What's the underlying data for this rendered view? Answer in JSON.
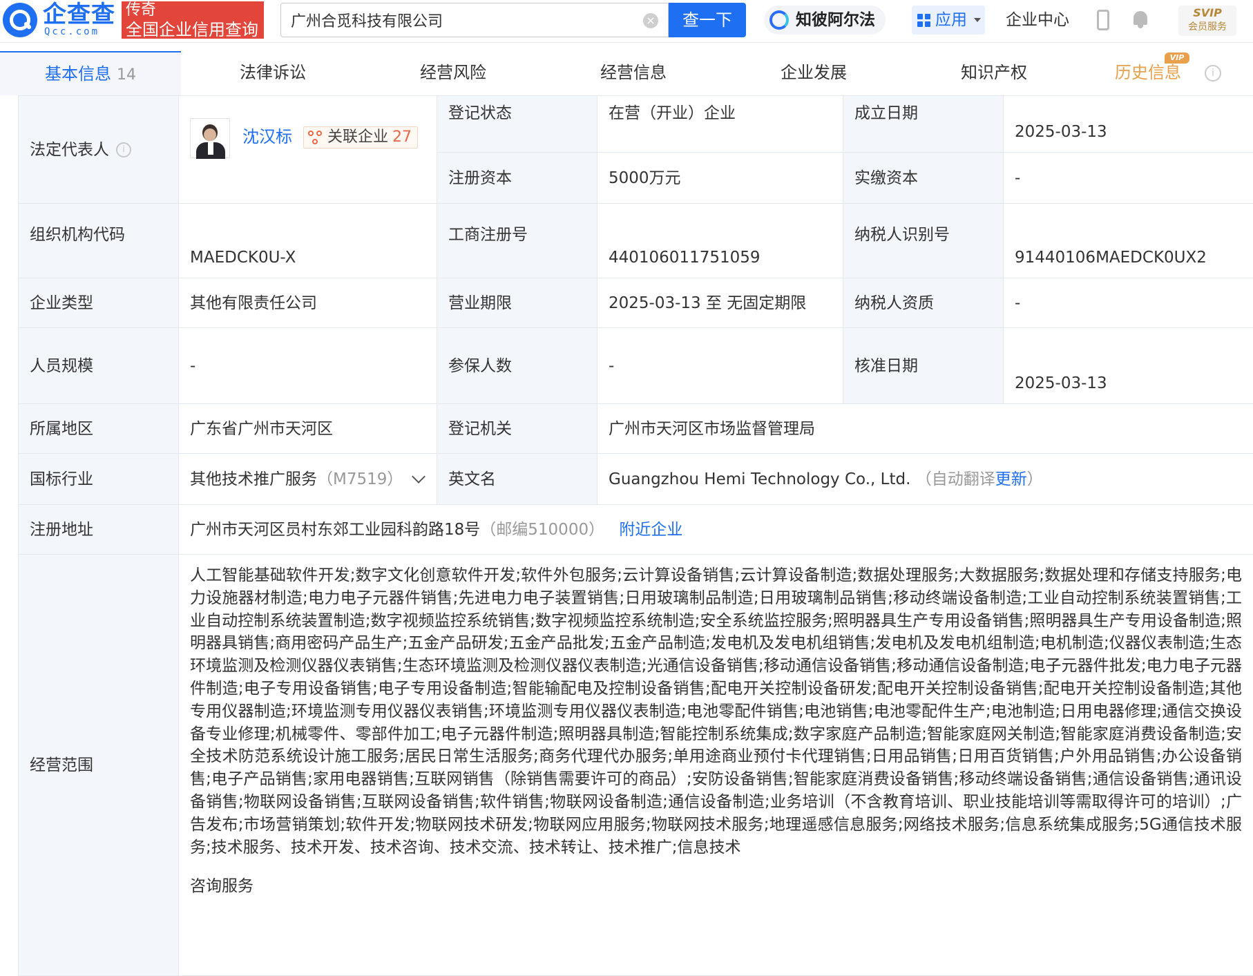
{
  "header": {
    "logo_text": "企查查",
    "logo_sub": "Qcc.com",
    "promo_line1": "传奇",
    "promo_line2": "全国企业信用查询",
    "search_value": "广州合觅科技有限公司",
    "search_button": "查一下",
    "zhibi_label": "知彼阿尔法",
    "apps_label": "应用",
    "enterprise_center": "企业中心",
    "svip_title": "SVIP",
    "svip_sub": "会员服务"
  },
  "tabs": [
    {
      "label": "基本信息",
      "count": "14"
    },
    {
      "label": "法律诉讼"
    },
    {
      "label": "经营风险"
    },
    {
      "label": "经营信息"
    },
    {
      "label": "企业发展"
    },
    {
      "label": "知识产权"
    },
    {
      "label": "历史信息",
      "badge": "VIP"
    }
  ],
  "info": {
    "legal_rep_label": "法定代表人",
    "legal_rep_name": "沈汉标",
    "related_label": "关联企业",
    "related_count": "27",
    "reg_status_label": "登记状态",
    "reg_status": "在营（开业）企业",
    "founded_label": "成立日期",
    "founded": "2025-03-13",
    "reg_capital_label": "注册资本",
    "reg_capital": "5000万元",
    "paid_capital_label": "实缴资本",
    "paid_capital": "-",
    "org_code_label": "组织机构代码",
    "org_code": "MAEDCK0U-X",
    "biz_reg_no_label": "工商注册号",
    "biz_reg_no": "440106011751059",
    "taxpayer_id_label": "纳税人识别号",
    "taxpayer_id": "91440106MAEDCK0UX2",
    "company_type_label": "企业类型",
    "company_type": "其他有限责任公司",
    "biz_term_label": "营业期限",
    "biz_term": "2025-03-13 至 无固定期限",
    "taxpayer_qual_label": "纳税人资质",
    "taxpayer_qual": "-",
    "staff_size_label": "人员规模",
    "staff_size": "-",
    "insured_label": "参保人数",
    "insured": "-",
    "approval_date_label": "核准日期",
    "approval_date": "2025-03-13",
    "region_label": "所属地区",
    "region": "广东省广州市天河区",
    "reg_authority_label": "登记机关",
    "reg_authority": "广州市天河区市场监督管理局",
    "industry_label": "国标行业",
    "industry": "其他技术推广服务",
    "industry_code": "（M7519）",
    "english_name_label": "英文名",
    "english_name": "Guangzhou Hemi Technology Co., Ltd.",
    "auto_translate": "（自动翻译",
    "update_link": "更新",
    "close_paren": "）",
    "address_label": "注册地址",
    "address": "广州市天河区员村东郊工业园科韵路18号",
    "postcode": "（邮编510000）",
    "nearby_link": "附近企业",
    "scope_label": "经营范围",
    "scope": "人工智能基础软件开发;数字文化创意软件开发;软件外包服务;云计算设备销售;云计算设备制造;数据处理服务;大数据服务;数据处理和存储支持服务;电力设施器材制造;电力电子元器件销售;先进电力电子装置销售;日用玻璃制品制造;日用玻璃制品销售;移动终端设备制造;工业自动控制系统装置销售;工业自动控制系统装置制造;数字视频监控系统销售;数字视频监控系统制造;安全系统监控服务;照明器具生产专用设备销售;照明器具生产专用设备制造;照明器具销售;商用密码产品生产;五金产品研发;五金产品批发;五金产品制造;发电机及发电机组销售;发电机及发电机组制造;电机制造;仪器仪表制造;生态环境监测及检测仪器仪表销售;生态环境监测及检测仪器仪表制造;光通信设备销售;移动通信设备销售;移动通信设备制造;电子元器件批发;电力电子元器件制造;电子专用设备销售;电子专用设备制造;智能输配电及控制设备销售;配电开关控制设备研发;配电开关控制设备销售;配电开关控制设备制造;其他专用仪器制造;环境监测专用仪器仪表销售;环境监测专用仪器仪表制造;电池零配件销售;电池销售;电池零配件生产;电池制造;日用电器修理;通信交换设备专业修理;机械零件、零部件加工;电子元器件制造;照明器具制造;智能控制系统集成;数字家庭产品制造;智能家庭网关制造;智能家庭消费设备制造;安全技术防范系统设计施工服务;居民日常生活服务;商务代理代办服务;单用途商业预付卡代理销售;日用品销售;日用百货销售;户外用品销售;办公设备销售;电子产品销售;家用电器销售;互联网销售（除销售需要许可的商品）;安防设备销售;智能家庭消费设备销售;移动终端设备销售;通信设备销售;通讯设备销售;物联网设备销售;互联网设备销售;软件销售;物联网设备制造;通信设备制造;业务培训（不含教育培训、职业技能培训等需取得许可的培训）;广告发布;市场营销策划;软件开发;物联网技术研发;物联网应用服务;物联网技术服务;地理遥感信息服务;网络技术服务;信息系统集成服务;5G通信技术服务;技术服务、技术开发、技术咨询、技术交流、技术转让、技术推广;信息技术",
    "scope_tail": "咨询服务"
  }
}
